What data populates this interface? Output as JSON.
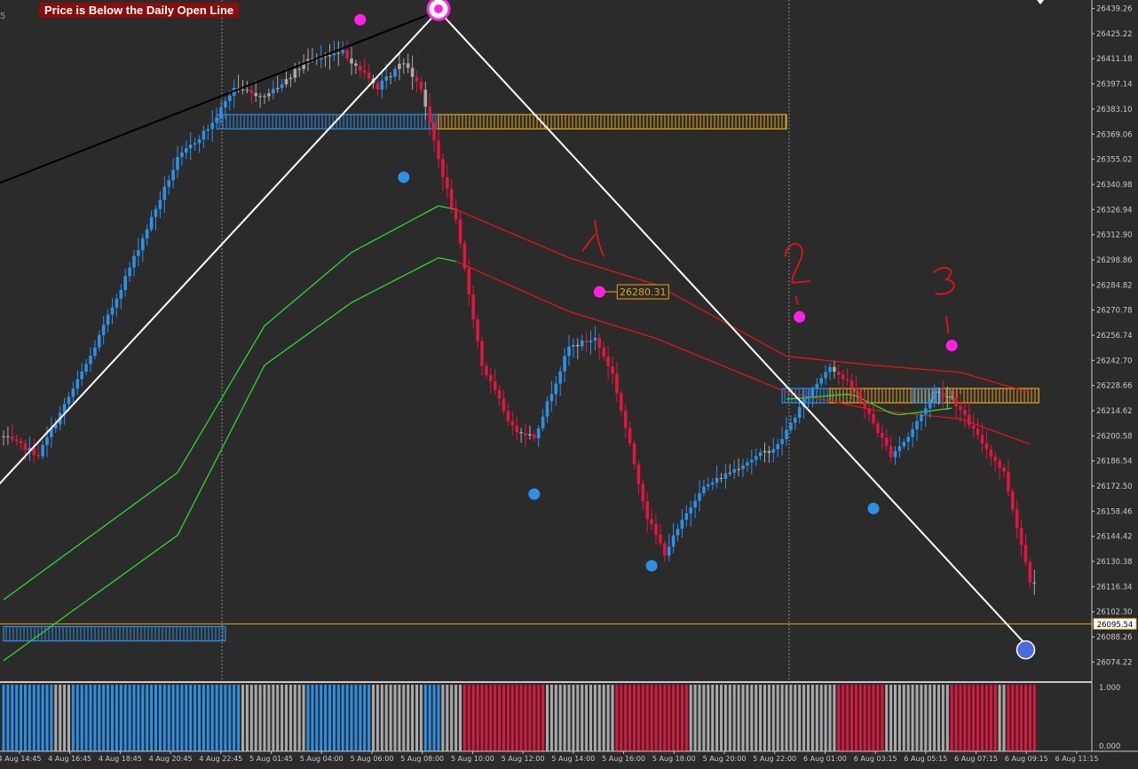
{
  "window": {
    "banner": "Price is Below the Daily Open Line",
    "corner_label": "5"
  },
  "colors": {
    "bg": "#2b2b2b",
    "bull": "#2e8fe6",
    "bear": "#e0163e",
    "neutral": "#a9a9a9",
    "ma_green": "#2ad82a",
    "ma_red": "#e01515",
    "zone_orange": "#e6a21e",
    "zone_blue": "#2e8fe6",
    "pivot_high": "#ff22e0",
    "pivot_low": "#2e8fe6",
    "zigzag": "#ffffff"
  },
  "chart_data": {
    "type": "candlestick",
    "timeframe": "M5",
    "price_axis": {
      "ylim": [
        26064.0,
        26444.0
      ],
      "ticks": [
        "26439.26",
        "26425.22",
        "26411.18",
        "26397.14",
        "26383.10",
        "26369.06",
        "26355.02",
        "26340.98",
        "26326.94",
        "26312.90",
        "26298.86",
        "26284.82",
        "26270.78",
        "26256.74",
        "26242.70",
        "26228.66",
        "26214.62",
        "26200.58",
        "26186.54",
        "26172.50",
        "26158.46",
        "26144.42",
        "26130.38",
        "26116.34",
        "26102.30",
        "26088.26",
        "26074.22"
      ],
      "current_price": "26095.54"
    },
    "time_axis": {
      "labels": [
        "4 Aug 14:45",
        "4 Aug 16:45",
        "4 Aug 18:45",
        "4 Aug 20:45",
        "4 Aug 22:45",
        "5 Aug 01:45",
        "5 Aug 04:00",
        "5 Aug 06:00",
        "5 Aug 08:00",
        "5 Aug 10:00",
        "5 Aug 12:00",
        "5 Aug 14:00",
        "5 Aug 16:00",
        "5 Aug 18:00",
        "5 Aug 20:00",
        "5 Aug 22:00",
        "6 Aug 01:00",
        "6 Aug 03:15",
        "6 Aug 05:15",
        "6 Aug 07:15",
        "6 Aug 09:15",
        "6 Aug 11:15"
      ],
      "separators": [
        "5 Aug 00:00",
        "6 Aug 00:00"
      ]
    },
    "close_path": [
      {
        "i": 0,
        "p": 26200
      },
      {
        "i": 8,
        "p": 26190
      },
      {
        "i": 20,
        "p": 26245
      },
      {
        "i": 30,
        "p": 26300
      },
      {
        "i": 40,
        "p": 26355
      },
      {
        "i": 48,
        "p": 26375
      },
      {
        "i": 53,
        "p": 26395
      },
      {
        "i": 60,
        "p": 26390
      },
      {
        "i": 70,
        "p": 26410
      },
      {
        "i": 78,
        "p": 26415
      },
      {
        "i": 86,
        "p": 26395
      },
      {
        "i": 92,
        "p": 26410
      },
      {
        "i": 96,
        "p": 26395
      },
      {
        "i": 100,
        "p": 26355
      },
      {
        "i": 104,
        "p": 26320
      },
      {
        "i": 110,
        "p": 26240
      },
      {
        "i": 117,
        "p": 26205
      },
      {
        "i": 122,
        "p": 26200
      },
      {
        "i": 130,
        "p": 26250
      },
      {
        "i": 136,
        "p": 26255
      },
      {
        "i": 140,
        "p": 26235
      },
      {
        "i": 148,
        "p": 26155
      },
      {
        "i": 152,
        "p": 26135
      },
      {
        "i": 160,
        "p": 26170
      },
      {
        "i": 170,
        "p": 26185
      },
      {
        "i": 178,
        "p": 26195
      },
      {
        "i": 184,
        "p": 26220
      },
      {
        "i": 190,
        "p": 26240
      },
      {
        "i": 196,
        "p": 26225
      },
      {
        "i": 204,
        "p": 26190
      },
      {
        "i": 208,
        "p": 26200
      },
      {
        "i": 214,
        "p": 26225
      },
      {
        "i": 218,
        "p": 26222
      },
      {
        "i": 224,
        "p": 26200
      },
      {
        "i": 230,
        "p": 26180
      },
      {
        "i": 236,
        "p": 26120
      }
    ],
    "moving_averages": [
      {
        "name": "green_1",
        "color": "#2ad82a",
        "points": [
          {
            "i": 0,
            "p": 26109
          },
          {
            "i": 40,
            "p": 26180
          },
          {
            "i": 60,
            "p": 26262
          },
          {
            "i": 80,
            "p": 26303
          },
          {
            "i": 100,
            "p": 26329
          },
          {
            "i": 104,
            "p": 26327
          }
        ]
      },
      {
        "name": "green_2",
        "color": "#2ad82a",
        "points": [
          {
            "i": 0,
            "p": 26075
          },
          {
            "i": 40,
            "p": 26145
          },
          {
            "i": 60,
            "p": 26240
          },
          {
            "i": 80,
            "p": 26275
          },
          {
            "i": 100,
            "p": 26300
          },
          {
            "i": 104,
            "p": 26298
          }
        ]
      },
      {
        "name": "red_1",
        "color": "#e01515",
        "points": [
          {
            "i": 104,
            "p": 26327
          },
          {
            "i": 130,
            "p": 26300
          },
          {
            "i": 150,
            "p": 26285
          },
          {
            "i": 180,
            "p": 26245
          },
          {
            "i": 200,
            "p": 26240
          },
          {
            "i": 220,
            "p": 26236
          },
          {
            "i": 237,
            "p": 26224
          }
        ]
      },
      {
        "name": "red_2",
        "color": "#e01515",
        "points": [
          {
            "i": 104,
            "p": 26298
          },
          {
            "i": 130,
            "p": 26270
          },
          {
            "i": 150,
            "p": 26255
          },
          {
            "i": 180,
            "p": 26225
          },
          {
            "i": 200,
            "p": 26215
          },
          {
            "i": 220,
            "p": 26210
          },
          {
            "i": 237,
            "p": 26195
          }
        ]
      },
      {
        "name": "green_3",
        "color": "#2ad82a",
        "points": [
          {
            "i": 180,
            "p": 26221
          },
          {
            "i": 195,
            "p": 26224
          },
          {
            "i": 205,
            "p": 26212
          },
          {
            "i": 218,
            "p": 26216
          }
        ]
      }
    ],
    "zones": [
      {
        "color": "#2e8fe6",
        "i1": 49,
        "i2": 100,
        "top": 26380,
        "bottom": 26372
      },
      {
        "color": "#e6a21e",
        "i1": 100,
        "i2": 180,
        "top": 26380,
        "bottom": 26372
      },
      {
        "color": "#2e8fe6",
        "i1": 0,
        "i2": 51,
        "top": 26094,
        "bottom": 26086
      },
      {
        "color": "#2e8fe6",
        "i1": 179,
        "i2": 190,
        "top": 26227,
        "bottom": 26219
      },
      {
        "color": "#e6a21e",
        "i1": 190,
        "i2": 238,
        "top": 26227,
        "bottom": 26219
      },
      {
        "color": "#2e8fe6",
        "i1": 209,
        "i2": 216,
        "top": 26227,
        "bottom": 26219
      }
    ],
    "zigzag": [
      {
        "i": -10,
        "p": 26150
      },
      {
        "i": 100,
        "p": 26438
      },
      {
        "i": 235,
        "p": 26084
      }
    ],
    "trendline": {
      "color": "#000000",
      "points": [
        {
          "i": -8,
          "p": 26335
        },
        {
          "i": 100,
          "p": 26438
        }
      ]
    },
    "daily_open": 26095.54,
    "pivots": [
      {
        "type": "high",
        "i": 82,
        "p": 26433
      },
      {
        "type": "low",
        "i": 92,
        "p": 26345
      },
      {
        "type": "low",
        "i": 122,
        "p": 26168
      },
      {
        "type": "high",
        "i": 137,
        "p": 26281,
        "label": "26280.31"
      },
      {
        "type": "low",
        "i": 149,
        "p": 26128
      },
      {
        "type": "high",
        "i": 183,
        "p": 26267
      },
      {
        "type": "low",
        "i": 200,
        "p": 26160
      },
      {
        "type": "high",
        "i": 218,
        "p": 26251
      },
      {
        "type": "big_high",
        "i": 100,
        "p": 26439
      },
      {
        "type": "big_low",
        "i": 235,
        "p": 26081
      }
    ],
    "annotations": [
      "1",
      "2",
      "3"
    ],
    "histogram": {
      "ticks": [
        "1.000",
        "0.000"
      ],
      "segments": [
        {
          "from": 0,
          "to": 11,
          "c": "b"
        },
        {
          "from": 12,
          "to": 15,
          "c": "n"
        },
        {
          "from": 16,
          "to": 54,
          "c": "b"
        },
        {
          "from": 55,
          "to": 69,
          "c": "n"
        },
        {
          "from": 70,
          "to": 84,
          "c": "b"
        },
        {
          "from": 85,
          "to": 96,
          "c": "n"
        },
        {
          "from": 97,
          "to": 100,
          "c": "b"
        },
        {
          "from": 101,
          "to": 105,
          "c": "n"
        },
        {
          "from": 106,
          "to": 124,
          "c": "r"
        },
        {
          "from": 125,
          "to": 140,
          "c": "n"
        },
        {
          "from": 141,
          "to": 157,
          "c": "r"
        },
        {
          "from": 158,
          "to": 191,
          "c": "n"
        },
        {
          "from": 192,
          "to": 202,
          "c": "r"
        },
        {
          "from": 203,
          "to": 217,
          "c": "n"
        },
        {
          "from": 218,
          "to": 228,
          "c": "r"
        },
        {
          "from": 229,
          "to": 230,
          "c": "n"
        },
        {
          "from": 231,
          "to": 237,
          "c": "r"
        }
      ]
    }
  }
}
